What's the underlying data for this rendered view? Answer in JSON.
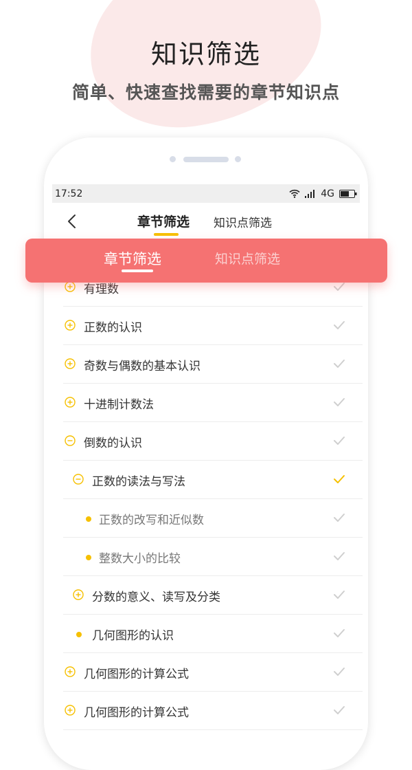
{
  "hero": {
    "title": "知识筛选",
    "subtitle": "简单、快速查找需要的章节知识点"
  },
  "status_bar": {
    "time": "17:52",
    "network": "4G"
  },
  "nav": {
    "tabs": [
      {
        "label": "章节筛选",
        "active": true
      },
      {
        "label": "知识点筛选",
        "active": false
      }
    ]
  },
  "overlay_tabs": [
    {
      "label": "章节筛选",
      "active": true
    },
    {
      "label": "知识点筛选",
      "active": false
    }
  ],
  "colors": {
    "accent": "#f6c000",
    "overlay": "#f57272",
    "check_inactive": "#cfcfcf"
  },
  "list": [
    {
      "label": "有理数",
      "level": 0,
      "icon": "plus-circle-icon",
      "checked": false
    },
    {
      "label": "正数的认识",
      "level": 0,
      "icon": "plus-circle-icon",
      "checked": false
    },
    {
      "label": "奇数与偶数的基本认识",
      "level": 0,
      "icon": "plus-circle-icon",
      "checked": false
    },
    {
      "label": "十进制计数法",
      "level": 0,
      "icon": "plus-circle-icon",
      "checked": false
    },
    {
      "label": "倒数的认识",
      "level": 0,
      "icon": "minus-circle-icon",
      "checked": false
    },
    {
      "label": "正数的读法与写法",
      "level": 1,
      "icon": "minus-circle-icon",
      "checked": true
    },
    {
      "label": "正数的改写和近似数",
      "level": 2,
      "icon": "bullet-dot-icon",
      "checked": false
    },
    {
      "label": "整数大小的比较",
      "level": 2,
      "icon": "bullet-dot-icon",
      "checked": false
    },
    {
      "label": "分数的意义、读写及分类",
      "level": 1,
      "icon": "plus-circle-icon",
      "checked": false
    },
    {
      "label": "几何图形的认识",
      "level": 1,
      "icon": "bullet-dot-icon",
      "checked": false
    },
    {
      "label": "几何图形的计算公式",
      "level": 0,
      "icon": "plus-circle-icon",
      "checked": false
    },
    {
      "label": "几何图形的计算公式",
      "level": 0,
      "icon": "plus-circle-icon",
      "checked": false
    }
  ]
}
